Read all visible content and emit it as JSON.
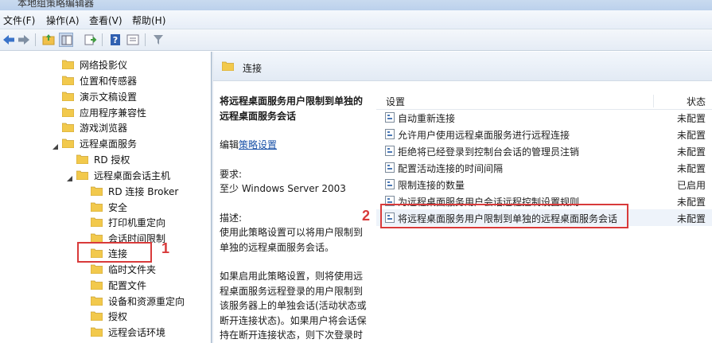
{
  "window": {
    "title": "本地组策略编辑器"
  },
  "menu": [
    {
      "label": "文件(F)"
    },
    {
      "label": "操作(A)"
    },
    {
      "label": "查看(V)"
    },
    {
      "label": "帮助(H)"
    }
  ],
  "toolbar": {
    "icons": [
      "back-icon",
      "forward-icon",
      "up-folder-icon",
      "show-hide-tree-icon",
      "export-list-icon",
      "help-icon",
      "view-icon",
      "filter-icon"
    ]
  },
  "tree": [
    {
      "label": "网络投影仪"
    },
    {
      "label": "位置和传感器"
    },
    {
      "label": "演示文稿设置"
    },
    {
      "label": "应用程序兼容性"
    },
    {
      "label": "游戏浏览器"
    },
    {
      "label": "远程桌面服务"
    },
    {
      "label": "RD 授权"
    },
    {
      "label": "远程桌面会话主机"
    },
    {
      "label": "RD 连接 Broker"
    },
    {
      "label": "安全"
    },
    {
      "label": "打印机重定向"
    },
    {
      "label": "会话时间限制"
    },
    {
      "label": "连接"
    },
    {
      "label": "临时文件夹"
    },
    {
      "label": "配置文件"
    },
    {
      "label": "设备和资源重定向"
    },
    {
      "label": "授权"
    },
    {
      "label": "远程会话环境"
    }
  ],
  "right_header": {
    "title": "连接"
  },
  "description": {
    "heading": "将远程桌面服务用户限制到单独的远程桌面服务会话",
    "edit_prefix": "编辑",
    "edit_link": "策略设置",
    "req_label": "要求:",
    "req_value": "至少 Windows Server 2003",
    "desc_label": "描述:",
    "desc_text": "使用此策略设置可以将用户限制到单独的远程桌面服务会话。",
    "desc_text2": "如果启用此策略设置，则将使用远程桌面服务远程登录的用户限制到该服务器上的单独会话(活动状态或断开连接状态)。如果用户将会话保持在断开连接状态，则下次登录时用户将自动"
  },
  "list": {
    "col_setting": "设置",
    "col_state": "状态",
    "rows": [
      {
        "label": "自动重新连接",
        "state": "未配置"
      },
      {
        "label": "允许用户使用远程桌面服务进行远程连接",
        "state": "未配置"
      },
      {
        "label": "拒绝将已经登录到控制台会话的管理员注销",
        "state": "未配置"
      },
      {
        "label": "配置活动连接的时间间隔",
        "state": "未配置"
      },
      {
        "label": "限制连接的数量",
        "state": "已启用"
      },
      {
        "label": "为远程桌面服务用户会话远程控制设置规则",
        "state": "未配置"
      },
      {
        "label": "将远程桌面服务用户限制到单独的远程桌面服务会话",
        "state": "未配置"
      }
    ]
  },
  "annotations": {
    "step1": "1",
    "step2": "2"
  },
  "colors": {
    "annotation": "#d83a3a",
    "link": "#1a52a8",
    "folder": "#f2c94c"
  }
}
